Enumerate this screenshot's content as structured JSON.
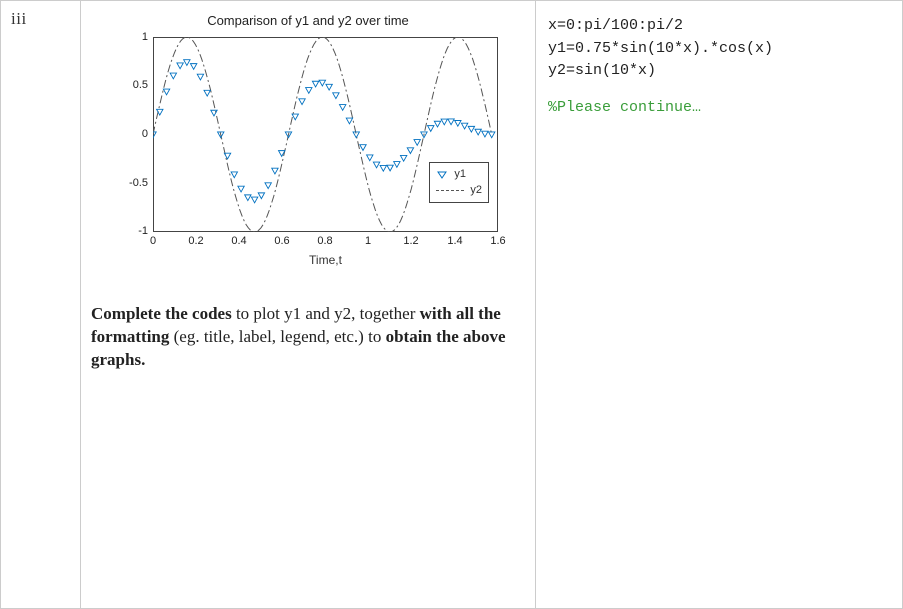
{
  "label": "iii",
  "chart_data": {
    "type": "line",
    "title": "Comparison of y1 and y2 over time",
    "xlabel": "Time,t",
    "x_ticks": [
      "0",
      "0.2",
      "0.4",
      "0.6",
      "0.8",
      "1",
      "1.2",
      "1.4",
      "1.6"
    ],
    "y_ticks": [
      "1",
      "0.5",
      "0",
      "-0.5",
      "-1"
    ],
    "xlim": [
      0,
      1.6
    ],
    "ylim": [
      -1,
      1
    ],
    "legend": {
      "items": [
        "y1",
        "y2"
      ],
      "position": "lower-right"
    },
    "series": [
      {
        "name": "y1",
        "style": "blue triangle markers",
        "expr": "0.75*sin(10*x).*cos(x)",
        "x_range": "0:pi/100:pi/2"
      },
      {
        "name": "y2",
        "style": "black dash-dot line",
        "expr": "sin(10*x)",
        "x_range": "0:pi/100:pi/2"
      }
    ]
  },
  "code": {
    "l1": "x=0:pi/100:pi/2",
    "l2": "y1=0.75*sin(10*x).*cos(x)",
    "l3": "y2=sin(10*x)",
    "l4": "%Please continue…"
  },
  "question": {
    "p1a": "Complete the codes",
    "p1b": " to plot y1 and y2, together ",
    "p2a": "with all the formatting",
    "p2b": " (eg. title, label, legend, etc.) to ",
    "p3": "obtain the above graphs."
  }
}
